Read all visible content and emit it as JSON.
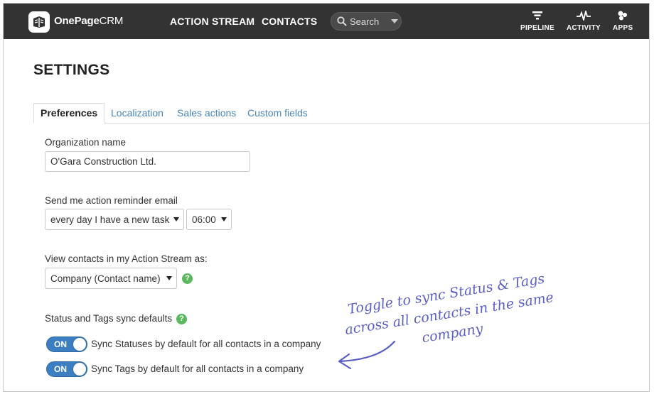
{
  "app": {
    "brand_bold": "OnePage",
    "brand_regular": "CRM"
  },
  "nav": {
    "action_stream": "ACTION STREAM",
    "contacts": "CONTACTS",
    "search_placeholder": "Search",
    "pipeline": "PIPELINE",
    "activity": "ACTIVITY",
    "apps": "APPS"
  },
  "page": {
    "title": "SETTINGS"
  },
  "tabs": [
    {
      "label": "Preferences",
      "active": true
    },
    {
      "label": "Localization",
      "active": false
    },
    {
      "label": "Sales actions",
      "active": false
    },
    {
      "label": "Custom fields",
      "active": false
    }
  ],
  "form": {
    "org_label": "Organization name",
    "org_value": "O'Gara Construction Ltd.",
    "reminder_label": "Send me action reminder email",
    "reminder_frequency": "every day I have a new task",
    "reminder_time": "06:00",
    "view_label": "View contacts in my Action Stream as:",
    "view_value": "Company (Contact name)",
    "sync_label": "Status and Tags sync defaults",
    "help_glyph": "?",
    "toggle_statuses_state": "ON",
    "toggle_statuses_label": "Sync Statuses by default for all contacts in a company",
    "toggle_tags_state": "ON",
    "toggle_tags_label": "Sync Tags by default for all contacts in a company"
  },
  "annotation": {
    "line1": "Toggle to sync Status & Tags",
    "line2": "across all contacts in the same",
    "line3": "company"
  },
  "colors": {
    "topbar": "#333333",
    "link": "#4a86b8",
    "toggle_on": "#3b7ec2",
    "help": "#5cb85c",
    "annotation": "#5a5fc4"
  }
}
